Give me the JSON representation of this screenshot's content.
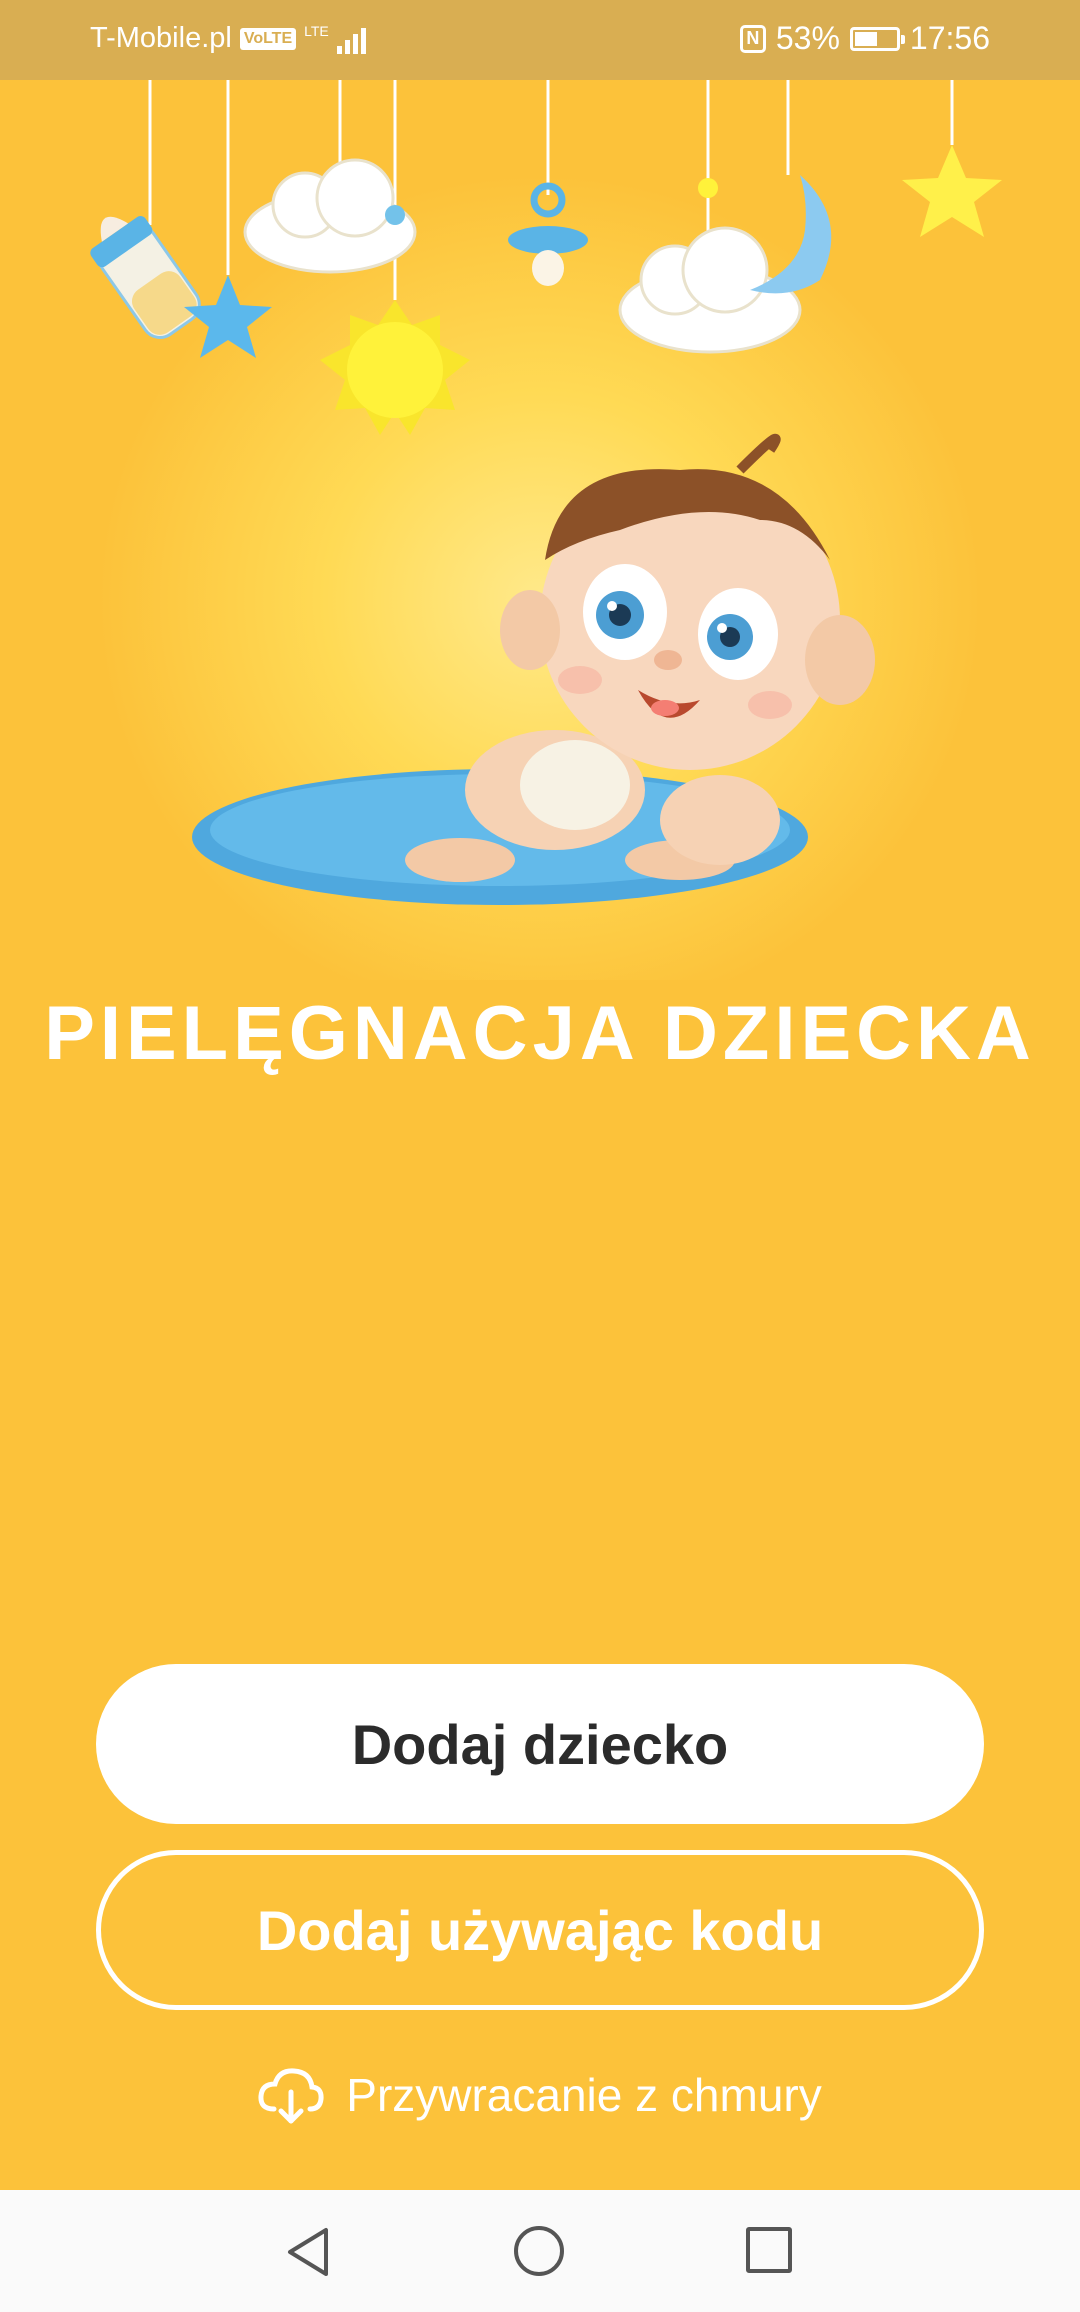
{
  "status_bar": {
    "carrier": "T-Mobile.pl",
    "volte": "VoLTE",
    "network": "LTE",
    "battery": "53%",
    "time": "17:56"
  },
  "title": "PIELĘGNACJA DZIECKA",
  "buttons": {
    "add_child": "Dodaj dziecko",
    "add_with_code": "Dodaj używając kodu",
    "restore_cloud": "Przywracanie z chmury"
  },
  "colors": {
    "background": "#FCC23A",
    "status_bar": "#D9AE52",
    "button_text": "#2b2b2b"
  },
  "icons": {
    "restore": "cloud-download-icon",
    "nav_back": "back-triangle-icon",
    "nav_home": "home-circle-icon",
    "nav_recent": "recent-square-icon"
  }
}
